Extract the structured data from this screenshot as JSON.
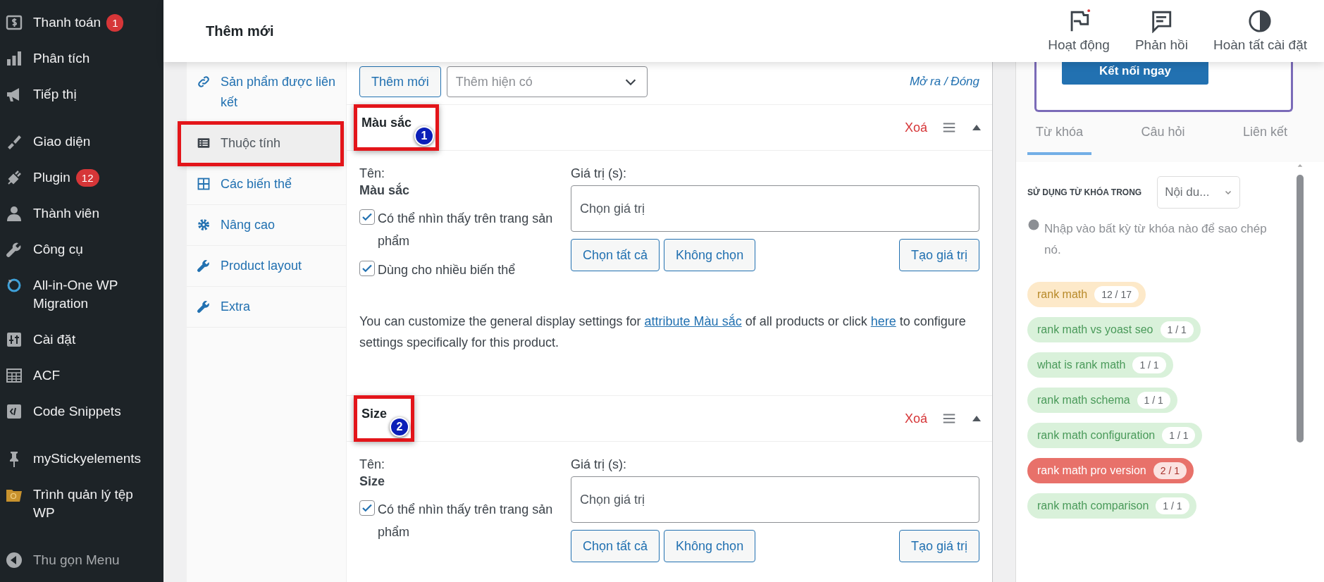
{
  "sidebar": {
    "groups": [
      {
        "items": [
          {
            "label": "Thanh toán",
            "badge": "1"
          },
          {
            "label": "Phân tích"
          },
          {
            "label": "Tiếp thị"
          }
        ]
      },
      {
        "items": [
          {
            "label": "Giao diện"
          },
          {
            "label": "Plugin",
            "badge": "12"
          },
          {
            "label": "Thành viên"
          },
          {
            "label": "Công cụ"
          },
          {
            "label": "All-in-One WP Migration"
          },
          {
            "label": "Cài đặt"
          },
          {
            "label": "ACF"
          },
          {
            "label": "Code Snippets"
          }
        ]
      },
      {
        "items": [
          {
            "label": "myStickyelements"
          },
          {
            "label": "Trình quản lý tệp WP"
          }
        ]
      }
    ],
    "collapse": "Thu gọn Menu"
  },
  "top_bar": {
    "title": "Thêm mới",
    "actions": [
      {
        "label": "Hoạt động",
        "notify": true
      },
      {
        "label": "Phản hồi",
        "notify": false
      },
      {
        "label": "Hoàn tất cài đặt",
        "notify": false
      }
    ]
  },
  "product_tabs": [
    {
      "label": "Sản phẩm được liên kết",
      "selected": false,
      "annotated": false
    },
    {
      "label": "Thuộc tính",
      "selected": true,
      "annotated": true
    },
    {
      "label": "Các biến thể",
      "selected": false,
      "annotated": false
    },
    {
      "label": "Nâng cao",
      "selected": false,
      "annotated": false
    },
    {
      "label": "Product layout",
      "selected": false,
      "annotated": false
    },
    {
      "label": "Extra",
      "selected": false,
      "annotated": false
    }
  ],
  "toolbar": {
    "add_button": "Thêm mới",
    "existing_select": "Thêm hiện có",
    "expand_link": "Mở ra / Đóng"
  },
  "attributes": [
    {
      "name": "Màu sắc",
      "callout": "1",
      "remove": "Xoá",
      "name_label": "Tên:",
      "name_value": "Màu sắc",
      "values_label": "Giá trị (s):",
      "values_placeholder": "Chọn giá trị",
      "checks": [
        {
          "label": "Có thể nhìn thấy trên trang sản phẩm",
          "checked": true
        },
        {
          "label": "Dùng cho nhiều biến thể",
          "checked": true
        }
      ],
      "buttons": [
        "Chọn tất cả",
        "Không chọn"
      ],
      "create_button": "Tạo giá trị",
      "description": [
        {
          "kind": "text",
          "text": "You can customize the general display settings for "
        },
        {
          "kind": "link",
          "text": "attribute Màu sắc"
        },
        {
          "kind": "text",
          "text": " of all products or click "
        },
        {
          "kind": "link",
          "text": "here"
        },
        {
          "kind": "text",
          "text": " to configure settings specifically for this product."
        }
      ]
    },
    {
      "name": "Size",
      "callout": "2",
      "remove": "Xoá",
      "name_label": "Tên:",
      "name_value": "Size",
      "values_label": "Giá trị (s):",
      "values_placeholder": "Chọn giá trị",
      "checks": [
        {
          "label": "Có thể nhìn thấy trên trang sản phẩm",
          "checked": true
        }
      ],
      "buttons": [
        "Chọn tất cả",
        "Không chọn"
      ],
      "create_button": "Tạo giá trị"
    }
  ],
  "seo_panel": {
    "connect_button": "Kết nối ngay",
    "tabs": [
      {
        "label": "Từ khóa",
        "selected": true
      },
      {
        "label": "Câu hỏi",
        "selected": false
      },
      {
        "label": "Liên kết",
        "selected": false
      }
    ],
    "heading": "SỬ DỤNG TỪ KHÓA TRONG",
    "select": "Nội du...",
    "hint": "Nhập vào bất kỳ từ khóa nào để sao chép nó.",
    "keywords": [
      {
        "text": "rank math",
        "count": "12 / 17",
        "color": "#fde9c9"
      },
      {
        "text": "rank math vs yoast seo",
        "count": "1 / 1",
        "color": "#d9f1da"
      },
      {
        "text": "what is rank math",
        "count": "1 / 1",
        "color": "#d9f1da"
      },
      {
        "text": "rank math schema",
        "count": "1 / 1",
        "color": "#d9f1da"
      },
      {
        "text": "rank math configuration",
        "count": "1 / 1",
        "color": "#d9f1da"
      },
      {
        "text": "rank math pro version",
        "count": "2 / 1",
        "color": "#e8716a"
      },
      {
        "text": "rank math comparison",
        "count": "1 / 1",
        "color": "#d9f1da"
      }
    ]
  }
}
